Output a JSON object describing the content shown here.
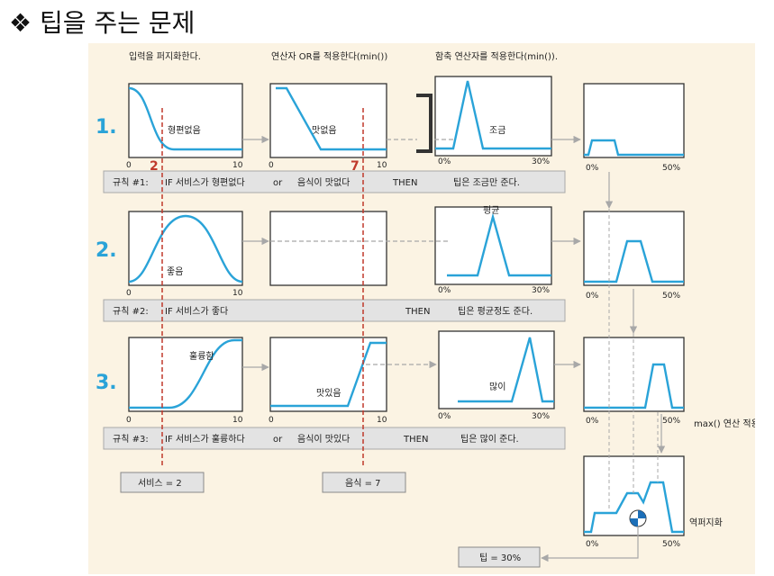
{
  "slide": {
    "bullet": "❖",
    "title": "팁을 주는 문제"
  },
  "headers": {
    "step1": "입력을 퍼지화한다.",
    "step2": "연산자 OR를 적용한다(min())",
    "step3": "함축 연산자를 적용한다(min())."
  },
  "rows": [
    {
      "number": "1.",
      "service_set": "형편없음",
      "food_set": "맛없음",
      "tip_set": "조금",
      "rule": {
        "id": "규칙 #1:",
        "if_part": "IF  서비스가 형편없다",
        "op": "or",
        "cond2": "음식이 맛없다",
        "then": "THEN",
        "consequence": "팁은 조금만 준다."
      }
    },
    {
      "number": "2.",
      "service_set": "좋음",
      "food_set": "",
      "tip_set": "평균",
      "rule": {
        "id": "규칙 #2:",
        "if_part": "IF  서비스가 좋다",
        "op": "",
        "cond2": "",
        "then": "THEN",
        "consequence": "팁은 평균정도 준다."
      }
    },
    {
      "number": "3.",
      "service_set": "훌륭함",
      "food_set": "맛있음",
      "tip_set": "많이",
      "rule": {
        "id": "규칙 #3:",
        "if_part": "IF  서비스가 훌륭하다",
        "op": "or",
        "cond2": "음식이 맛있다",
        "then": "THEN",
        "consequence": "팁은 많이 준다."
      }
    }
  ],
  "axis": {
    "input_min": "0",
    "input_max": "10",
    "tip_min": "0%",
    "tip_max": "30%",
    "agg_min": "0%",
    "agg_max": "50%"
  },
  "inputs": {
    "service_marker": "2",
    "food_marker": "7",
    "service_box": "서비스 = 2",
    "food_box": "음식 = 7"
  },
  "aggregation_label": "max() 연산 적용",
  "defuzz_label": "역퍼지화",
  "result_box": "팁 = 30%",
  "colors": {
    "curve": "#2aa3d8",
    "number": "#2aa3d8",
    "marker": "#c0392b",
    "figure_bg": "#fbf3e3",
    "rule_bar": "#e3e3e3",
    "arrow": "#a8a8a8"
  }
}
